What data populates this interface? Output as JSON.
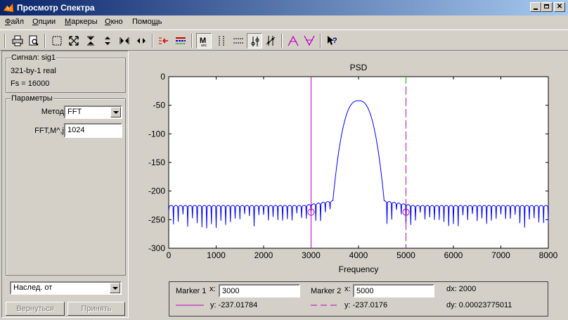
{
  "window": {
    "title": "Просмотр Спектра"
  },
  "menu": [
    {
      "pre": "",
      "u": "Ф",
      "post": "айл"
    },
    {
      "pre": "",
      "u": "О",
      "post": "пции"
    },
    {
      "pre": "",
      "u": "М",
      "post": "аркеры"
    },
    {
      "pre": "",
      "u": "О",
      "post": "кно"
    },
    {
      "pre": "Помо",
      "u": "щ",
      "post": "ь"
    }
  ],
  "signal": {
    "group_title": "Сигнал: sig1",
    "size": "321-by-1 real",
    "fs": "Fs = 16000"
  },
  "params": {
    "group_title": "Параметры",
    "method_label": "Метод",
    "method_value": "FFT",
    "fft_label": "FFT,M^,j",
    "fft_value": "1024"
  },
  "inherit": {
    "value": "Наслед. от"
  },
  "buttons": {
    "revert": "Вернуться",
    "apply": "Принять"
  },
  "chart_data": {
    "type": "line",
    "title": "PSD",
    "xlabel": "Frequency",
    "ylabel": "",
    "xlim": [
      0,
      8000
    ],
    "ylim": [
      -300,
      0
    ],
    "xticks": [
      0,
      1000,
      2000,
      3000,
      4000,
      5000,
      6000,
      7000,
      8000
    ],
    "yticks": [
      0,
      -50,
      -100,
      -150,
      -200,
      -250,
      -300
    ],
    "grid": false,
    "series": [
      {
        "color": "#0000ff",
        "peak": {
          "x": 4000,
          "y": -42
        },
        "main_lobe": [
          3450,
          4550
        ],
        "sidelobe_level": -225,
        "null_spacing": 100
      }
    ],
    "markers": [
      {
        "x": 3000,
        "y": -237.01784,
        "color": "#bf00bf",
        "style": "solid"
      },
      {
        "x": 5000,
        "y": -237.0176,
        "color": "#00b000",
        "style": "dashed",
        "secondary_color": "#bf00bf"
      }
    ]
  },
  "markerpanel": {
    "m1_label": "Marker 1",
    "m2_label": "Marker 2",
    "x_label": "x:",
    "m1_x": "3000",
    "m2_x": "5000",
    "dx": "dx: 2000",
    "m1_y": "y: -237.01784",
    "m2_y": "y: -237.0176",
    "dy": "dy: 0.00023775011"
  }
}
